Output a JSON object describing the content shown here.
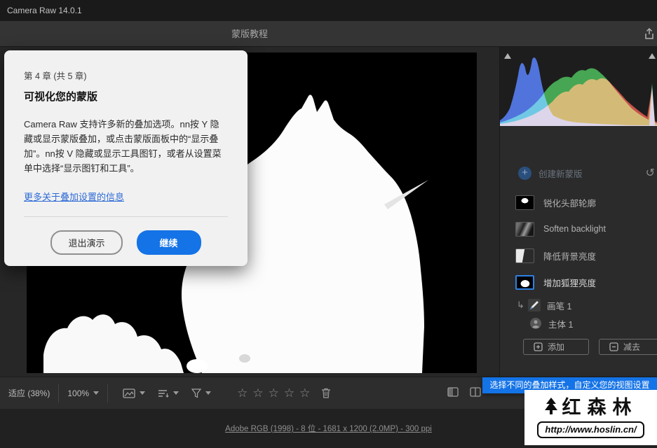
{
  "titlebar": {
    "title": "Camera Raw 14.0.1"
  },
  "header": {
    "title": "蒙版教程"
  },
  "dialog": {
    "chapter": "第 4 章 (共 5 章)",
    "title": "可视化您的蒙版",
    "body": "Camera Raw 支持许多新的叠加选项。nn按 Y 隐藏或显示蒙版叠加，或点击蒙版面板中的“显示叠加”。nn按 V 隐藏或显示工具图钉，或者从设置菜单中选择“显示图钉和工具”。",
    "link": "更多关于叠加设置的信息",
    "exit_label": "退出演示",
    "continue_label": "继续"
  },
  "mask_panel": {
    "create_new_label": "创建新蒙版",
    "masks": [
      {
        "label": "锐化头部轮廓"
      },
      {
        "label": "Soften backlight"
      },
      {
        "label": "降低背景亮度"
      },
      {
        "label": "增加狐狸亮度"
      }
    ],
    "components": [
      {
        "label": "画笔 1"
      },
      {
        "label": "主体 1"
      }
    ],
    "add_label": "添加",
    "subtract_label": "减去"
  },
  "toolbar": {
    "fit_label": "适应 (38%)",
    "zoom_label": "100%"
  },
  "statusbar": {
    "info_link": "Adobe RGB (1998) - 8 位 - 1681 x 1200 (2.0MP) - 300 ppi"
  },
  "tooltip": {
    "text": "选择不同的叠加样式，自定义您的视图设置"
  },
  "watermark": {
    "brand": "红森林",
    "url": "http://www.hoslin.cn/"
  },
  "icons": {
    "star": "☆",
    "reset": "↺",
    "branch": "↳",
    "plus": "+"
  },
  "colors": {
    "accent_blue": "#1473e6",
    "link_blue": "#2e6bd6"
  }
}
